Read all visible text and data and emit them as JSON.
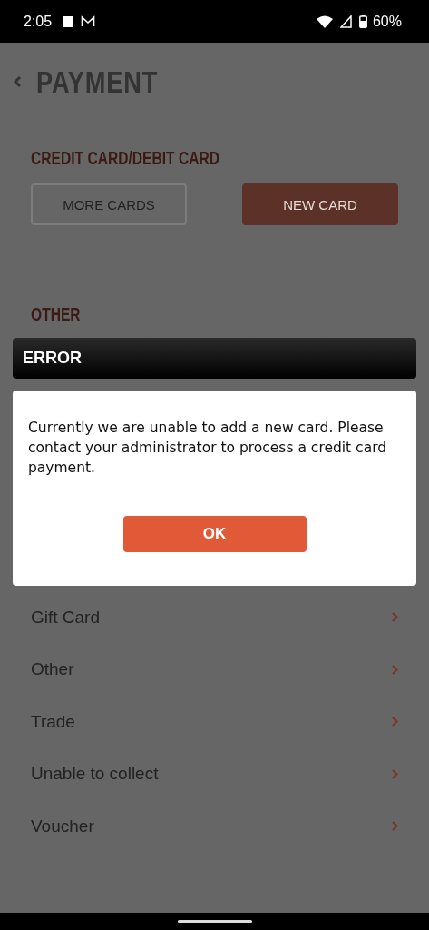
{
  "status_bar": {
    "time": "2:05",
    "battery": "60%"
  },
  "header": {
    "title": "PAYMENT"
  },
  "card_section": {
    "title": "CREDIT CARD/DEBIT CARD",
    "buttons": [
      {
        "label": "MORE CARDS",
        "kind": "outline"
      },
      {
        "label": "NEW CARD",
        "kind": "filled"
      }
    ]
  },
  "other_section": {
    "title": "OTHER",
    "items": [
      {
        "label": "Gift Card"
      },
      {
        "label": "Other"
      },
      {
        "label": "Trade"
      },
      {
        "label": "Unable to collect"
      },
      {
        "label": "Voucher"
      }
    ]
  },
  "dialog": {
    "title": "ERROR",
    "message": "Currently we are unable to add a new card. Please contact your administrator to process a credit card payment.",
    "button": "OK"
  }
}
